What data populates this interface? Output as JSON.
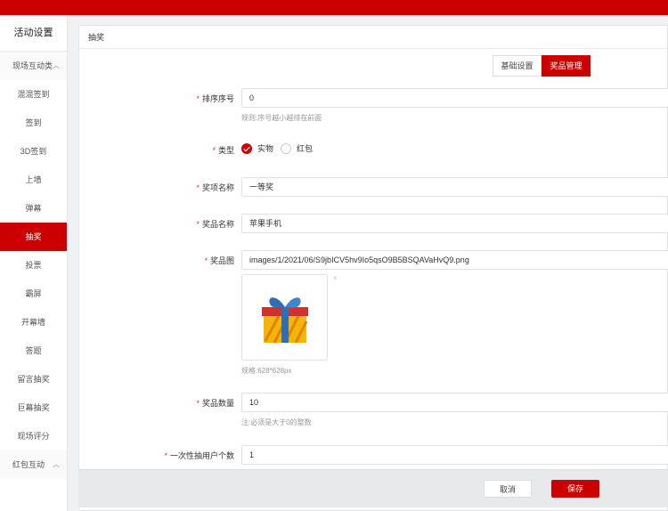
{
  "sidebar": {
    "title": "活动设置",
    "group1": "现场互动类",
    "items": [
      "混混签到",
      "签到",
      "3D签到",
      "上墙",
      "弹幕",
      "抽奖",
      "投票",
      "霸屏",
      "开幕墙",
      "答题",
      "留言抽奖",
      "巨幕抽奖",
      "现场评分"
    ],
    "group2": "红包互动",
    "active_index": 5
  },
  "panel": {
    "title": "抽奖"
  },
  "tabs": [
    "基础设置",
    "奖品管理"
  ],
  "form": {
    "sort": {
      "label": "排序序号",
      "value": "0",
      "hint": "规则:序号越小越排在前面"
    },
    "type": {
      "label": "类型",
      "options": [
        "实物",
        "红包"
      ],
      "selected": "实物"
    },
    "prize_level": {
      "label": "奖项名称",
      "value": "一等奖"
    },
    "prize_name": {
      "label": "奖品名称",
      "value": "苹果手机"
    },
    "prize_image": {
      "label": "奖品图",
      "value": "images/1/2021/06/S9jbICV5hv9Io5qsO9B5BSQAVaHvQ9.png",
      "remove": "×",
      "hint": "规格:628*628px"
    },
    "prize_count": {
      "label": "奖品数量",
      "value": "10",
      "hint": "注:必须是大于0的整数"
    },
    "per_draw": {
      "label": "一次性抽用户个数",
      "value": "1"
    }
  },
  "footer": {
    "cancel": "取消",
    "save": "保存"
  },
  "colors": {
    "brand": "#cc0000"
  }
}
